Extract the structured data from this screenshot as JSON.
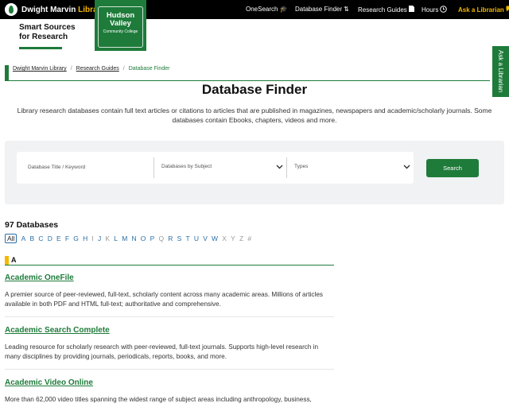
{
  "topbar": {
    "brand_part1": "Dwight Marvin ",
    "brand_part2": "Library",
    "nav": [
      {
        "label": "OneSearch",
        "icon": "graduation-cap-icon"
      },
      {
        "label": "Database Finder",
        "icon": "sort-icon"
      },
      {
        "label": "Research Guides",
        "icon": "document-icon"
      },
      {
        "label": "Hours",
        "icon": "clock-icon"
      }
    ],
    "ask": {
      "label": "Ask a Librarian",
      "icon": "chat-icon"
    }
  },
  "header": {
    "tagline_line1": "Smart Sources",
    "tagline_line2": "for Research",
    "logo_line1": "Hudson",
    "logo_line2": "Valley",
    "logo_line3": "Community College"
  },
  "side_tab": {
    "label": "Ask a Librarian"
  },
  "breadcrumb": {
    "items": [
      "Dwight Marvin Library",
      "Research Guides"
    ],
    "current": "Database Finder",
    "separator": "/"
  },
  "page": {
    "title": "Database Finder",
    "intro": "Library research databases contain full text articles or citations to articles that are published in magazines, newspapers and academic/scholarly journals. Some databases contain Ebooks, chapters, videos and more."
  },
  "search": {
    "keyword_placeholder": "Database Title / Keyword",
    "subject_label": "Databases by Subject",
    "types_label": "Types",
    "button_label": "Search"
  },
  "list": {
    "count_label": "97 Databases",
    "letters": [
      "All",
      "A",
      "B",
      "C",
      "D",
      "E",
      "F",
      "G",
      "H",
      "I",
      "J",
      "K",
      "L",
      "M",
      "N",
      "O",
      "P",
      "Q",
      "R",
      "S",
      "T",
      "U",
      "V",
      "W",
      "X",
      "Y",
      "Z",
      "#"
    ],
    "section_letter": "A",
    "databases": [
      {
        "title": "Academic OneFile",
        "description": "A premier source of peer-reviewed, full-text, scholarly content across many academic areas. Millions of articles available in both PDF and HTML full-text; authoritative and comprehensive."
      },
      {
        "title": "Academic Search Complete",
        "description": "Leading resource for scholarly research with peer-reviewed, full-text journals. Supports high-level research in many disciplines by providing journals, periodicals, reports, books, and more."
      },
      {
        "title": "Academic Video Online",
        "description": "More than 62,000 video titles spanning the widest range of subject areas including anthropology, business,"
      }
    ]
  },
  "colors": {
    "brand_green": "#1e7b3a",
    "accent_yellow": "#f5b800",
    "link_blue": "#2a6ea6"
  }
}
